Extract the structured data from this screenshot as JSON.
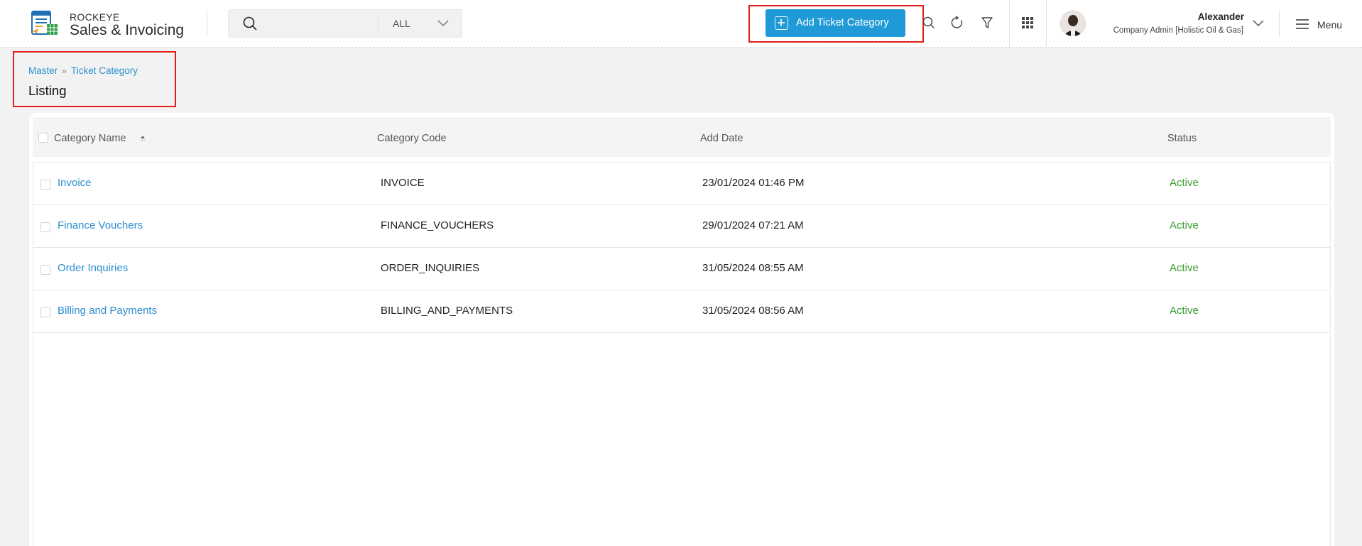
{
  "app": {
    "brand_top": "ROCKEYE",
    "brand_main": "Sales & Invoicing"
  },
  "search": {
    "placeholder": "",
    "scope": "ALL"
  },
  "toolbar": {
    "add_label": "Add Ticket Category"
  },
  "user": {
    "name": "Alexander",
    "role": "Company Admin [Holistic Oil & Gas]"
  },
  "menu": {
    "label": "Menu"
  },
  "breadcrumb": {
    "items": [
      "Master",
      "Ticket Category"
    ],
    "title": "Listing"
  },
  "table": {
    "columns": [
      "Category Name",
      "Category Code",
      "Add Date",
      "Status"
    ],
    "rows": [
      {
        "name": "Invoice",
        "code": "INVOICE",
        "date": "23/01/2024 01:46 PM",
        "status": "Active"
      },
      {
        "name": "Finance Vouchers",
        "code": "FINANCE_VOUCHERS",
        "date": "29/01/2024 07:21 AM",
        "status": "Active"
      },
      {
        "name": "Order Inquiries",
        "code": "ORDER_INQUIRIES",
        "date": "31/05/2024 08:55 AM",
        "status": "Active"
      },
      {
        "name": "Billing and Payments",
        "code": "BILLING_AND_PAYMENTS",
        "date": "31/05/2024 08:56 AM",
        "status": "Active"
      }
    ]
  },
  "colors": {
    "accent": "#1f9ad6",
    "link": "#2c8fd0",
    "status_active": "#3a9b2e",
    "highlight": "#e11d1d"
  },
  "icons": [
    "app-logo-icon",
    "search-icon",
    "chevron-down-icon",
    "plus-icon",
    "header-search-icon",
    "refresh-icon",
    "filter-icon",
    "apps-grid-icon",
    "hamburger-menu-icon",
    "sort-icon"
  ]
}
